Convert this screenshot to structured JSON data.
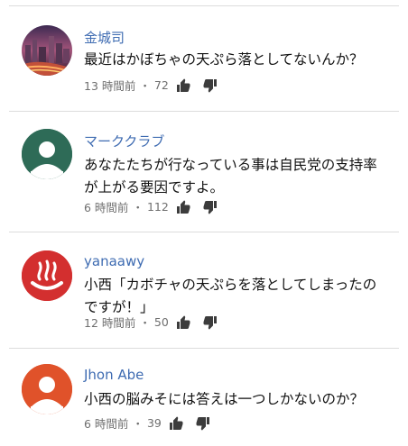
{
  "comments": [
    {
      "author": "金城司",
      "text": "最近はかぼちゃの天ぷら落としてないんか？",
      "time": "13 時間前",
      "likes": "72",
      "avatar_icon": "night-city-photo"
    },
    {
      "author": "マーククラブ",
      "text": "あなたたちが行なっている事は自民党の支持率が上がる要因ですよ。",
      "time": "6 時間前",
      "likes": "112",
      "avatar_icon": "default-person-avatar",
      "avatar_color": "#2e6b57"
    },
    {
      "author": "yanaawy",
      "text": "小西「カボチャの天ぷらを落としてしまったのですが！」",
      "time": "12 時間前",
      "likes": "50",
      "avatar_icon": "onsen-logo",
      "avatar_color": "#d32f2f"
    },
    {
      "author": "Jhon Abe",
      "text": "小西の脳みそには答えは一つしかないのか？",
      "time": "6 時間前",
      "likes": "39",
      "avatar_icon": "default-person-avatar",
      "avatar_color": "#e0522a"
    }
  ],
  "separator": "・"
}
